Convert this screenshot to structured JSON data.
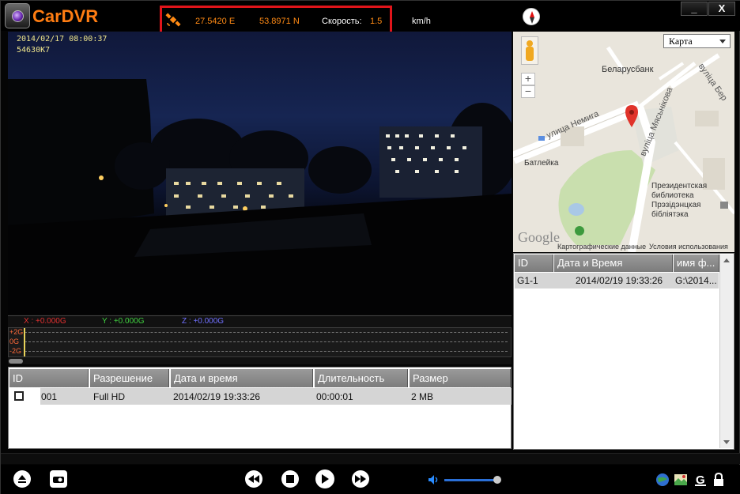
{
  "app": {
    "title": "CarDVR"
  },
  "window": {
    "minimize": "_",
    "close": "X"
  },
  "gps": {
    "longitude": "27.5420 E",
    "latitude": "53.8971 N",
    "speed_label": "Скорость:",
    "speed_value": "1.5",
    "speed_unit": "km/h"
  },
  "video": {
    "osd_datetime": "2014/02/17 08:00:37",
    "osd_id": "54630K7"
  },
  "gsensor": {
    "x": "X : +0.000G",
    "y": "Y : +0.000G",
    "z": "Z : +0.000G",
    "ticks": [
      "+2G",
      "0G",
      "-2G"
    ]
  },
  "file_table": {
    "headers": [
      "ID",
      "Разрешение",
      "Дата и время",
      "Длительность",
      "Размер"
    ],
    "rows": [
      {
        "id": "001",
        "resolution": "Full HD",
        "datetime": "2014/02/19 19:33:26",
        "duration": "00:00:01",
        "size": "2 MB"
      }
    ]
  },
  "map": {
    "type_select": "Карта",
    "zoom_in": "+",
    "zoom_out": "−",
    "labels": {
      "bank": "Беларусбанк",
      "street1": "улица Немига",
      "street2": "вуліца Мясьнікова",
      "street3": "вуліца Бер",
      "poi1": "Батлейка",
      "poi2": "Президентская библиотека Прэзідэнцкая бібліятэка"
    },
    "logo": "Google",
    "footer_data": "Картографические данные",
    "footer_terms": "Условия использования"
  },
  "gps_list": {
    "headers": [
      "ID",
      "Дата и Время",
      "имя ф..."
    ],
    "rows": [
      {
        "id": "G1-1",
        "datetime": "2014/02/19 19:33:26",
        "file": "G:\\2014..."
      }
    ]
  },
  "controls": {
    "icons": [
      "eject-icon",
      "camera-icon",
      "rewind-icon",
      "stop-icon",
      "play-icon",
      "fast-forward-icon",
      "volume-icon",
      "globe-icon",
      "map-icon",
      "g-icon",
      "lock-icon"
    ],
    "volume_level": 0.95
  }
}
